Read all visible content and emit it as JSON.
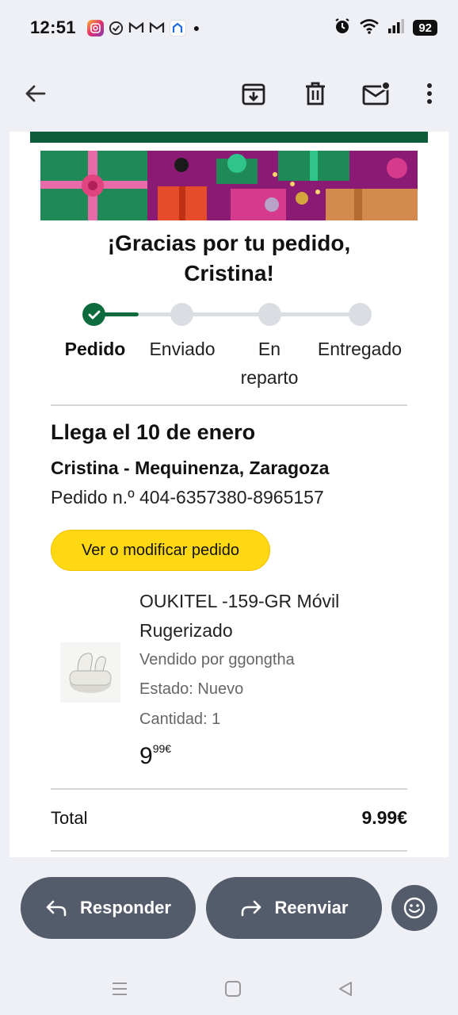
{
  "status_bar": {
    "time": "12:51",
    "notification_icons": [
      "instagram-icon",
      "check-circle-icon",
      "gmail-icon",
      "gmail-icon",
      "home-app-icon"
    ],
    "battery": "92"
  },
  "toolbar": {
    "icons": [
      "back-arrow-icon",
      "archive-icon",
      "delete-icon",
      "mark-unread-icon",
      "more-vert-icon"
    ]
  },
  "email": {
    "title_line1": "¡Gracias por tu pedido,",
    "title_line2": "Cristina!",
    "progress": {
      "steps": [
        "Pedido",
        "Enviado",
        "En reparto",
        "Entregado"
      ],
      "steps_split": {
        "step3_line1": "En",
        "step3_line2": "reparto"
      },
      "current_step": 1
    },
    "arrival": "Llega el 10 de enero",
    "address": "Cristina - Mequinenza, Zaragoza",
    "order_number": "Pedido n.º 404-6357380-8965157",
    "cta_label": "Ver o modificar pedido",
    "product": {
      "name": "OUKITEL -159-GR Móvil Rugerizado",
      "sold_by": "Vendido por ggongtha",
      "condition": "Estado: Nuevo",
      "quantity": "Cantidad: 1",
      "price_whole": "9",
      "price_fraction": "99€"
    },
    "total_label": "Total",
    "total_value": "9.99€"
  },
  "actions": {
    "reply": "Responder",
    "forward": "Reenviar"
  },
  "colors": {
    "accent_green": "#0e6b3d",
    "cta_yellow": "#ffd814",
    "action_button": "#545c6c"
  }
}
